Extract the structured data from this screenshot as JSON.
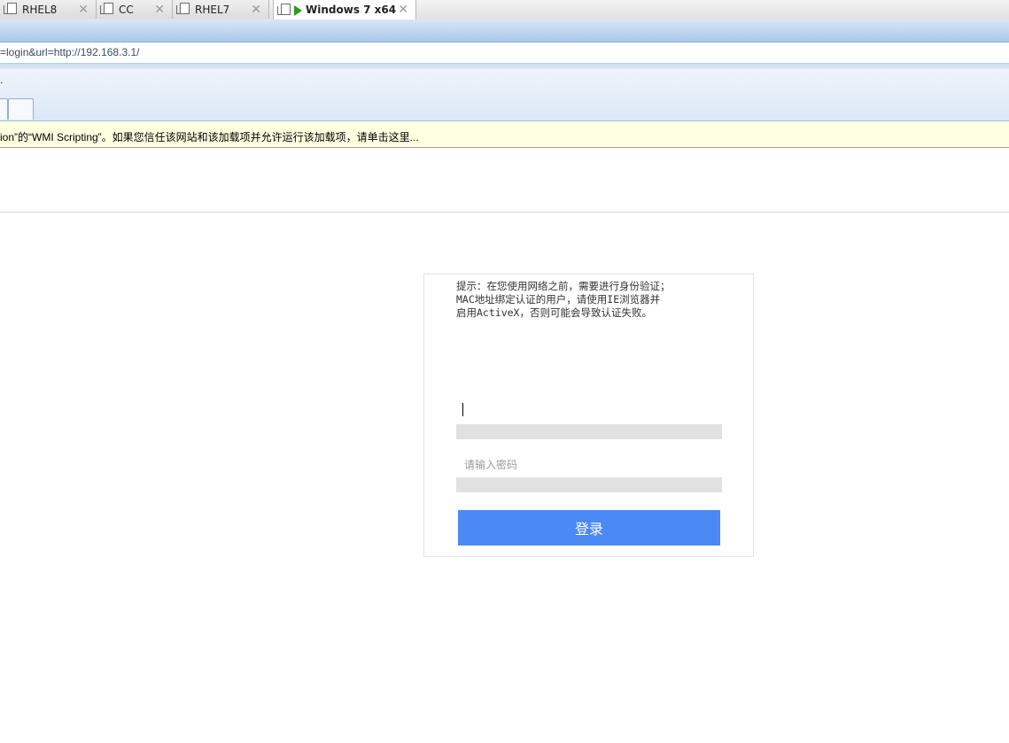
{
  "vm_tabs": [
    {
      "label": "RHEL8",
      "active": false
    },
    {
      "label": "CC",
      "active": false
    },
    {
      "label": "RHEL7",
      "active": false
    },
    {
      "label": "Windows 7 x64",
      "active": true
    }
  ],
  "vm_tab_close_glyph": "✕",
  "address_bar": {
    "url_text": "=login&url=http://192.168.3.1/"
  },
  "command_bar": {
    "glyph": "."
  },
  "info_bar": {
    "message": "ion”的“WMI Scripting”。如果您信任该网站和该加载项并允许运行该加载项，请单击这里..."
  },
  "login": {
    "notice": "提示：在您使用网络之前，需要进行身份验证；\nMAC地址绑定认证的用户，请使用IE浏览器并\n启用ActiveX，否则可能会导致认证失败。",
    "username_value": "",
    "password_placeholder": "请输入密码",
    "submit_label": "登录"
  },
  "colors": {
    "accent_button": "#4b8af5",
    "info_bar_bg": "#ffffe1",
    "running_vm_icon": "#2f9a1e"
  }
}
